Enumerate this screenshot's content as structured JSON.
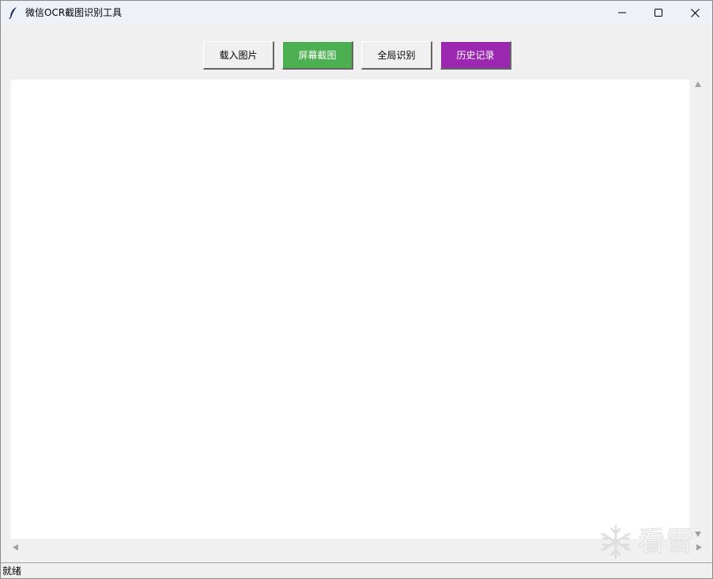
{
  "window": {
    "title": "微信OCR截图识别工具",
    "app_icon": "feather-icon"
  },
  "caption": {
    "minimize_icon": "minimize-icon",
    "maximize_icon": "maximize-icon",
    "close_icon": "close-icon"
  },
  "toolbar": {
    "load_image_label": "载入图片",
    "screen_capture_label": "屏幕截图",
    "global_recognize_label": "全局识别",
    "history_label": "历史记录"
  },
  "colors": {
    "screen_capture_bg": "#4caf50",
    "history_bg": "#9c27b0",
    "window_bg": "#f0f0f0",
    "titlebar_bg": "#eef1f7"
  },
  "text_area": {
    "content": ""
  },
  "watermark": {
    "text": "看雪",
    "icon": "snowflake-icon"
  },
  "status": {
    "text": "就绪"
  }
}
